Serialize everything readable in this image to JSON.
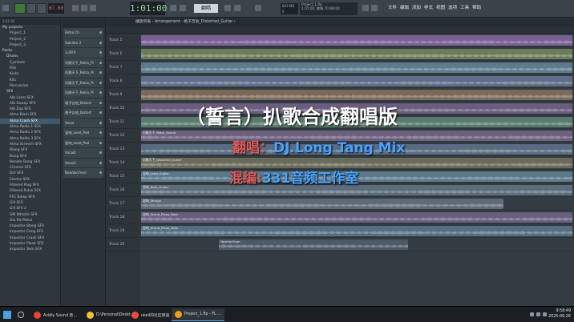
{
  "toolbar": {
    "bpm": "67.00",
    "time": "1:01:00",
    "pattern": "翻唱",
    "cpu": [
      "843 MB",
      "0"
    ],
    "hint": [
      "Project_1.flp",
      "1:01:00, 激情 70 BB:00"
    ],
    "menu": [
      "文件",
      "编辑",
      "添加",
      "样式",
      "视图",
      "选项",
      "工具",
      "帮助"
    ]
  },
  "sidebar": {
    "header": "1:01:00",
    "items": [
      {
        "label": "My projects",
        "folder": true
      },
      {
        "label": "Project_1",
        "folder": false
      },
      {
        "label": "Project_2",
        "folder": false
      },
      {
        "label": "Project_3",
        "folder": false
      },
      {
        "label": "Packs",
        "folder": true
      },
      {
        "label": "Drums",
        "folder": true
      },
      {
        "label": "Cymbals",
        "folder": false
      },
      {
        "label": "Fills",
        "folder": false
      },
      {
        "label": "Kicks",
        "folder": false
      },
      {
        "label": "Kits",
        "folder": false
      },
      {
        "label": "Percussion",
        "folder": false
      },
      {
        "label": "SFX",
        "folder": true
      },
      {
        "label": "Alb Lasm SFX",
        "folder": false
      },
      {
        "label": "Alb Sweep SFX",
        "folder": false
      },
      {
        "label": "Alb Zap SFX",
        "folder": false
      },
      {
        "label": "Alma Blam SFX",
        "folder": false
      },
      {
        "label": "Alma Crash SFX",
        "folder": false
      },
      {
        "label": "Alma Radio 1 SFX",
        "folder": false
      },
      {
        "label": "Alma Radio 2 SFX",
        "folder": false
      },
      {
        "label": "Alma Radio 3 SFX",
        "folder": false
      },
      {
        "label": "Alma Screech SFX",
        "folder": false
      },
      {
        "label": "Blang SFX",
        "folder": false
      },
      {
        "label": "Bung SFX",
        "folder": false
      },
      {
        "label": "Bender Bang SFX",
        "folder": false
      },
      {
        "label": "Chrome SFX",
        "folder": false
      },
      {
        "label": "Dril SFX",
        "folder": false
      },
      {
        "label": "Electro SFX",
        "folder": false
      },
      {
        "label": "Filtered Plug SFX",
        "folder": false
      },
      {
        "label": "Filtered Pulse SFX",
        "folder": false
      },
      {
        "label": "FFC Bleep SFX",
        "folder": false
      },
      {
        "label": "Gill SFX",
        "folder": false
      },
      {
        "label": "Gill SFX 2",
        "folder": false
      },
      {
        "label": "GM Whistle SFX",
        "folder": false
      },
      {
        "label": "Glo Rd Metal",
        "folder": false
      },
      {
        "label": "Impostor Blang SFX",
        "folder": false
      },
      {
        "label": "Impostor Cong SFX",
        "folder": false
      },
      {
        "label": "Impostor Crash SFX",
        "folder": false
      },
      {
        "label": "Impostor Plonk SFX",
        "folder": false
      },
      {
        "label": "Impostor Twin SFX",
        "folder": false
      }
    ]
  },
  "channels": [
    "Retro Ch",
    "Sub Bro 2",
    "人声FX",
    "问鼎天下_Retro_Pi",
    "问鼎天下_Retro_Pi",
    "问鼎天下_Retro_Pi",
    "问鼎天下_Retro_Pi",
    "格子吉他_Distort",
    "格子吉他_Distort",
    "Vocal",
    "混响_Lead_Pad",
    "混响_Lead_Pad",
    "Vocal2",
    "Vocal3",
    "NewVocFrom"
  ],
  "playlist": {
    "title": "播放列表 - Arrangement · 格子吉他_Distorted_Guitar ›",
    "tracks": [
      "Track 5",
      "Track 6",
      "Track 7",
      "Track 8",
      "Track 9",
      "Track 10",
      "Track 11",
      "Track 12",
      "Track 13",
      "Track 14",
      "Track 15",
      "Track 16",
      "Track 17",
      "Track 18",
      "Track 19",
      "Track 20"
    ],
    "clips": [
      {
        "lane": 0,
        "start": 0.0,
        "end": 1.0,
        "color": "#7a5f96",
        "label": ""
      },
      {
        "lane": 1,
        "start": 0.0,
        "end": 1.0,
        "color": "#6a7d5a",
        "label": ""
      },
      {
        "lane": 2,
        "start": 0.0,
        "end": 1.0,
        "color": "#5c7b8c",
        "label": ""
      },
      {
        "lane": 3,
        "start": 0.0,
        "end": 1.0,
        "color": "#5f6e86",
        "label": ""
      },
      {
        "lane": 4,
        "start": 0.0,
        "end": 1.0,
        "color": "#7b6a5a",
        "label": ""
      },
      {
        "lane": 5,
        "start": 0.0,
        "end": 1.0,
        "color": "#6b5c80",
        "label": ""
      },
      {
        "lane": 6,
        "start": 0.0,
        "end": 1.0,
        "color": "#5a7a6e",
        "label": ""
      },
      {
        "lane": 7,
        "start": 0.0,
        "end": 1.0,
        "color": "#6d5f7e",
        "label": "问鼎天下_Retro_Sound"
      },
      {
        "lane": 8,
        "start": 0.0,
        "end": 1.0,
        "color": "#586d82",
        "label": ""
      },
      {
        "lane": 9,
        "start": 0.0,
        "end": 1.0,
        "color": "#6a6a58",
        "label": "问鼎天下_Distorted_Guitar"
      },
      {
        "lane": 10,
        "start": 0.0,
        "end": 1.0,
        "color": "#5b7a8a",
        "label": "混响_Lead_Guitar"
      },
      {
        "lane": 11,
        "start": 0.0,
        "end": 1.0,
        "color": "#5c6c7a",
        "label": "混响_Dark_Guitar"
      },
      {
        "lane": 12,
        "start": 0.0,
        "end": 0.84,
        "color": "#5f6a76",
        "label": "混响_Strings"
      },
      {
        "lane": 13,
        "start": 0.0,
        "end": 1.0,
        "color": "#6a5e7e",
        "label": "混响_Grand_Piano_Bass"
      },
      {
        "lane": 14,
        "start": 0.0,
        "end": 1.0,
        "color": "#556f80",
        "label": "混响_Grand_Piano_Main"
      },
      {
        "lane": 15,
        "start": 0.18,
        "end": 0.62,
        "color": "#4d5a66",
        "label": "NewVocFrom"
      }
    ]
  },
  "overlay": {
    "title": "（誓言）扒歌合成翻唱版",
    "singer_label": "翻唱：",
    "singer_name": "DJ.Long Tang Mix",
    "mix_label": "混编:",
    "mix_name": "331音频工作室",
    "colors": {
      "singer_label": "#e05b5b",
      "singer_name": "#4ba3ff",
      "mix_label": "#e05b5b",
      "mix_name": "#4ba3ff"
    }
  },
  "taskbar": {
    "tasks": [
      {
        "label": "Acidly Sound 音…",
        "icon_color": "#ea4335",
        "icon": "chrome-icon"
      },
      {
        "label": "D:\\Personal\\Deskt…",
        "icon_color": "#f0c040",
        "icon": "folder-icon"
      },
      {
        "label": "ukeil的社区频道",
        "icon_color": "#e74c3c",
        "icon": "video-icon"
      },
      {
        "label": "Project_1.flp - FL …",
        "icon_color": "#f39c12",
        "icon": "fl-studio-icon"
      }
    ],
    "clock_time": "9:58:49",
    "clock_date": "2025-06-26"
  }
}
